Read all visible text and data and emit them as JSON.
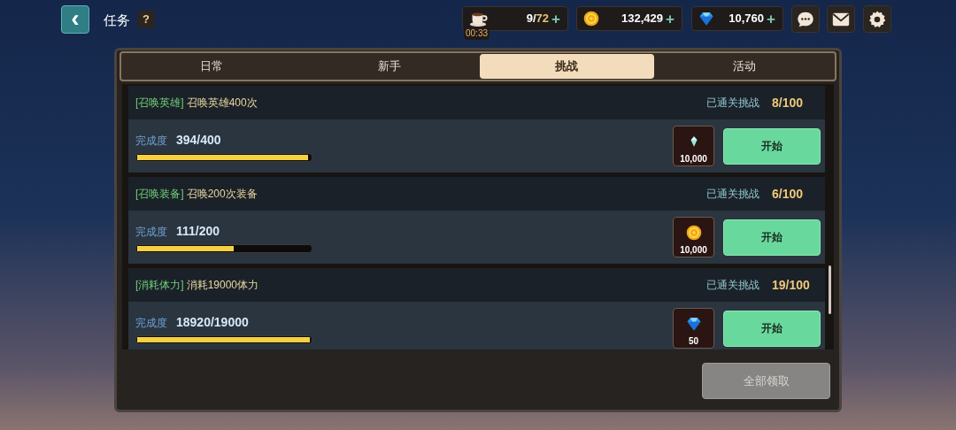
{
  "header": {
    "back": "‹",
    "title": "任务",
    "help": "?"
  },
  "resources": [
    {
      "kind": "stamina",
      "value": "9/",
      "max": "72",
      "plus": "+",
      "timer": "00:33"
    },
    {
      "kind": "coin",
      "value": "132,429",
      "plus": "+"
    },
    {
      "kind": "gem",
      "value": "10,760",
      "plus": "+"
    }
  ],
  "tabs": [
    {
      "label": "日常",
      "selected": false
    },
    {
      "label": "新手",
      "selected": false
    },
    {
      "label": "挑战",
      "selected": true
    },
    {
      "label": "活动",
      "selected": false
    }
  ],
  "quests": [
    {
      "tag": "[召唤英雄]",
      "text": "召唤英雄400次",
      "cleared_label": "已通关挑战",
      "cleared": "8/100",
      "progress_label": "完成度",
      "progress": "394/400",
      "level": 0.985,
      "reward": {
        "kind": "crystal",
        "amount": "10,000"
      },
      "button": "开始"
    },
    {
      "tag": "[召唤装备]",
      "text": "召唤200次装备",
      "cleared_label": "已通关挑战",
      "cleared": "6/100",
      "progress_label": "完成度",
      "progress": "111/200",
      "level": 0.555,
      "reward": {
        "kind": "coin",
        "amount": "10,000"
      },
      "button": "开始"
    },
    {
      "tag": "[消耗体力]",
      "text": "消耗19000体力",
      "cleared_label": "已通关挑战",
      "cleared": "19/100",
      "progress_label": "完成度",
      "progress": "18920/19000",
      "level": 0.996,
      "reward": {
        "kind": "gem",
        "amount": "50"
      },
      "button": "开始"
    }
  ],
  "claim_all": {
    "label": "全部领取",
    "disabled": true
  }
}
